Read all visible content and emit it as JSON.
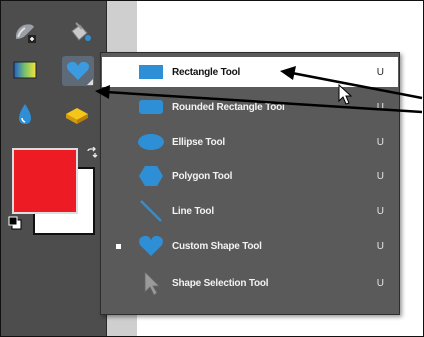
{
  "menu": {
    "items": [
      {
        "label": "Rectangle Tool",
        "shortcut": "U",
        "icon": "rectangle-shape-icon",
        "highlighted": true,
        "checked": false
      },
      {
        "label": "Rounded Rectangle Tool",
        "shortcut": "U",
        "icon": "rounded-rectangle-shape-icon",
        "highlighted": false,
        "checked": false
      },
      {
        "label": "Ellipse Tool",
        "shortcut": "U",
        "icon": "ellipse-shape-icon",
        "highlighted": false,
        "checked": false
      },
      {
        "label": "Polygon Tool",
        "shortcut": "U",
        "icon": "polygon-shape-icon",
        "highlighted": false,
        "checked": false
      },
      {
        "label": "Line Tool",
        "shortcut": "U",
        "icon": "line-shape-icon",
        "highlighted": false,
        "checked": false
      },
      {
        "label": "Custom Shape Tool",
        "shortcut": "U",
        "icon": "custom-heart-shape-icon",
        "highlighted": false,
        "checked": true
      },
      {
        "label": "Shape Selection Tool",
        "shortcut": "U",
        "icon": "shape-selection-arrow-icon",
        "highlighted": false,
        "checked": false
      }
    ]
  },
  "toolbox": {
    "tools": [
      "smart-brush-icon",
      "paint-bucket-icon",
      "gradient-icon",
      "custom-shape-icon",
      "blur-drop-icon",
      "sponge-icon"
    ],
    "foreground_color": "#ed1c24",
    "background_color": "#ffffff"
  },
  "colors": {
    "accent_blue": "#2f8fd6",
    "menu_bg": "#5a5a5a",
    "toolbox_bg": "#4d4d4d"
  }
}
